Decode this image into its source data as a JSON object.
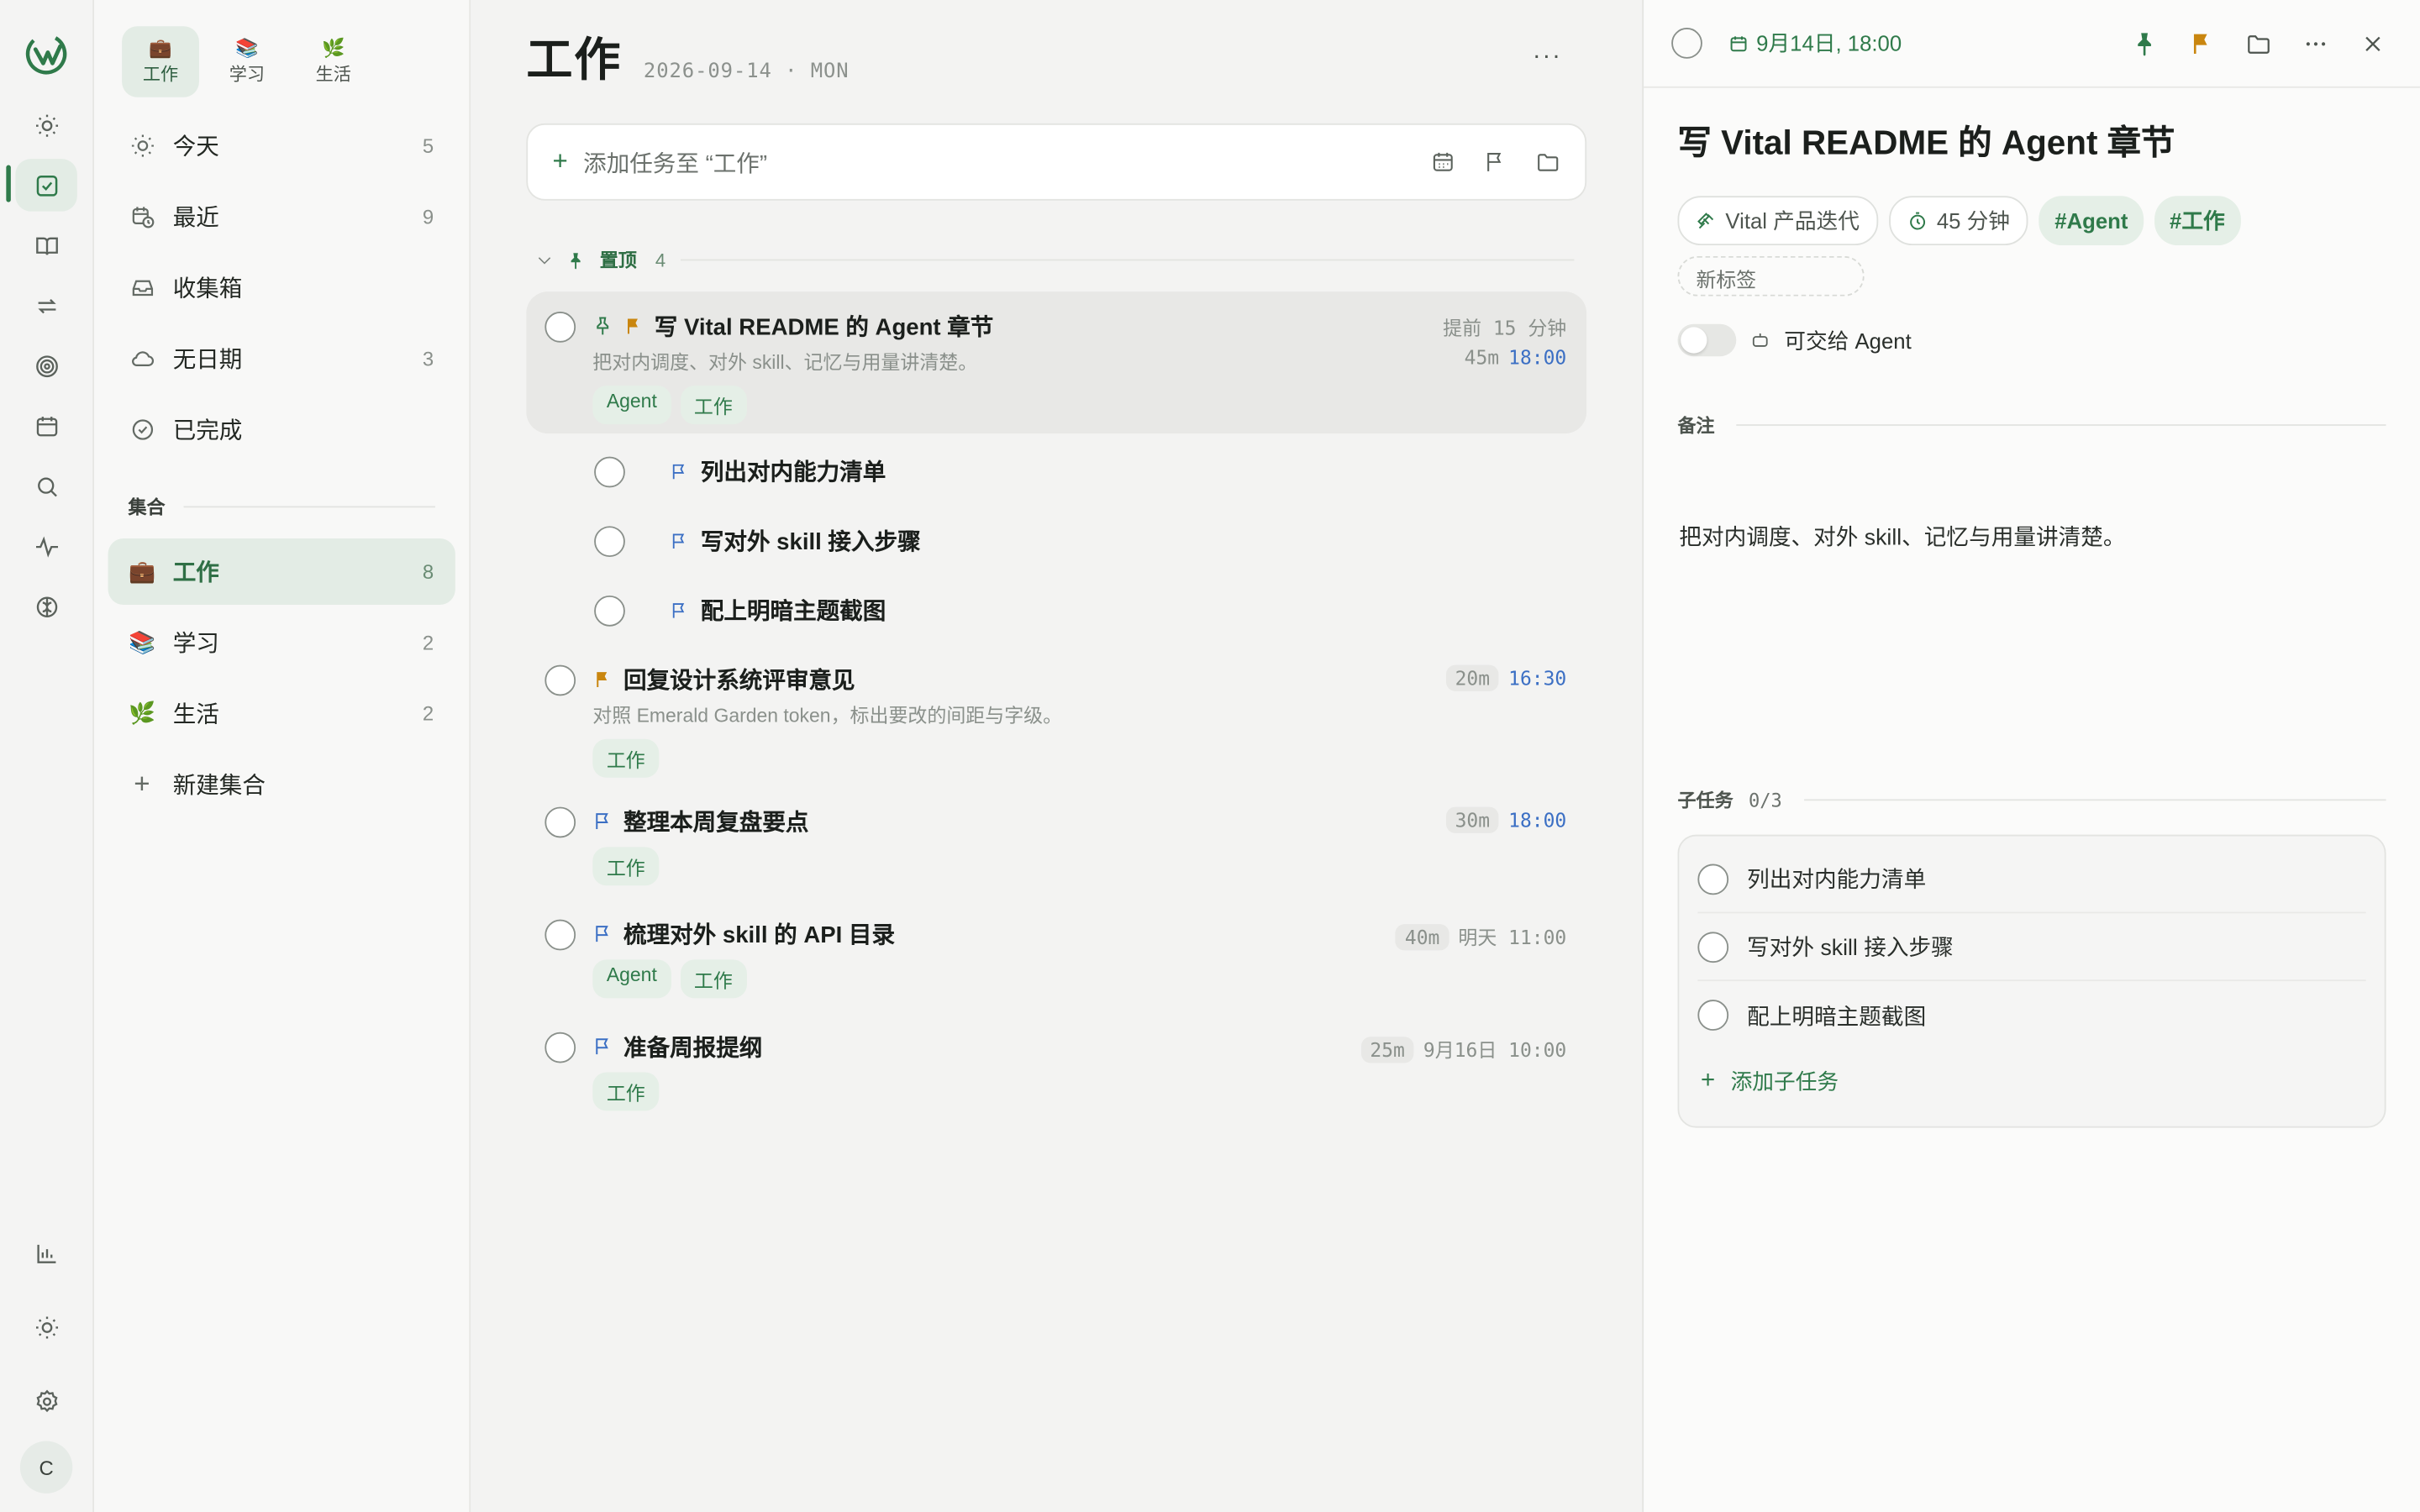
{
  "rail": {
    "icons": [
      "app-logo",
      "sun-icon",
      "checkbox-icon",
      "book-icon",
      "repeat-icon",
      "target-icon",
      "calendar-icon",
      "search-icon",
      "pulse-icon",
      "brain-icon"
    ],
    "bottom_icons": [
      "chart-icon",
      "sun-icon",
      "gear-icon"
    ],
    "avatar_letter": "C"
  },
  "sidebar": {
    "switcher": [
      {
        "emoji": "💼",
        "label": "工作"
      },
      {
        "emoji": "📚",
        "label": "学习"
      },
      {
        "emoji": "🌿",
        "label": "生活"
      }
    ],
    "smart_lists": [
      {
        "icon": "sun-icon",
        "label": "今天",
        "count": "5"
      },
      {
        "icon": "calendar-clock-icon",
        "label": "最近",
        "count": "9"
      },
      {
        "icon": "inbox-icon",
        "label": "收集箱",
        "count": ""
      },
      {
        "icon": "cloud-icon",
        "label": "无日期",
        "count": "3"
      },
      {
        "icon": "check-circle-icon",
        "label": "已完成",
        "count": ""
      }
    ],
    "collections_heading": "集合",
    "collections": [
      {
        "emoji": "💼",
        "label": "工作",
        "count": "8"
      },
      {
        "emoji": "📚",
        "label": "学习",
        "count": "2"
      },
      {
        "emoji": "🌿",
        "label": "生活",
        "count": "2"
      }
    ],
    "new_collection": "新建集合"
  },
  "main": {
    "title": "工作",
    "subtitle": "2026-09-14 · MON",
    "more": "···",
    "add_placeholder": "添加任务至 “工作”",
    "group": {
      "label": "置顶",
      "count": "4"
    },
    "tasks": [
      {
        "title": "写 Vital README 的 Agent 章节",
        "desc": "把对内调度、对外 skill、记忆与用量讲清楚。",
        "tags": [
          "Agent",
          "工作"
        ],
        "reminder": "提前 15 分钟",
        "duration": "45m",
        "time": "18:00"
      },
      {
        "subtitle_tasks": [
          "列出对内能力清单",
          "写对外 skill 接入步骤",
          "配上明暗主题截图"
        ]
      },
      {
        "title": "回复设计系统评审意见",
        "desc": "对照 Emerald Garden token，标出要改的间距与字级。",
        "tags": [
          "工作"
        ],
        "duration": "20m",
        "time": "16:30"
      },
      {
        "title": "整理本周复盘要点",
        "tags": [
          "工作"
        ],
        "duration": "30m",
        "time": "18:00"
      },
      {
        "title": "梳理对外 skill 的 API 目录",
        "tags": [
          "Agent",
          "工作"
        ],
        "duration": "40m",
        "date": "明天 11:00"
      },
      {
        "title": "准备周报提纲",
        "tags": [
          "工作"
        ],
        "duration": "25m",
        "date": "9月16日 10:00"
      }
    ]
  },
  "detail": {
    "date": "9月14日, 18:00",
    "title": "写 Vital README 的 Agent 章节",
    "project": "Vital 产品迭代",
    "duration": "45 分钟",
    "tags": [
      "#Agent",
      "#工作"
    ],
    "new_tag": "新标签",
    "agent_label": "可交给 Agent",
    "notes_heading": "备注",
    "notes": "把对内调度、对外 skill、记忆与用量讲清楚。",
    "subtasks_heading": "子任务",
    "subtasks_count": "0/3",
    "subtasks": [
      "列出对内能力清单",
      "写对外 skill 接入步骤",
      "配上明暗主题截图"
    ],
    "add_subtask": "添加子任务"
  },
  "colors": {
    "accent": "#2f7a4a",
    "accent_bg": "#e3ece5",
    "flag_orange": "#c9860f",
    "flag_blue": "#3b6fc4",
    "time_blue": "#3b6fc4"
  }
}
